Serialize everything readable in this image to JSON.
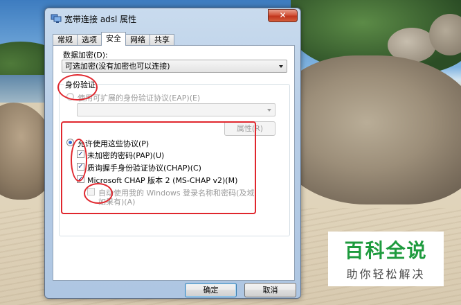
{
  "window": {
    "title": "宽带连接 adsl 属性",
    "close_label": "✕"
  },
  "tabs": [
    "常规",
    "选项",
    "安全",
    "网络",
    "共享"
  ],
  "active_tab": 2,
  "data_encryption": {
    "label": "数据加密(D):",
    "value": "可选加密(没有加密也可以连接)"
  },
  "authentication": {
    "group_title": "身份验证",
    "eap_option": "使用可扩展的身份验证协议(EAP)(E)",
    "eap_select_value": "",
    "properties_button": "属性(R)",
    "allow_protocols_option": "允许使用这些协议(P)",
    "protocols": [
      {
        "label": "未加密的密码(PAP)(U)",
        "checked": true
      },
      {
        "label": "质询握手身份验证协议(CHAP)(C)",
        "checked": true
      },
      {
        "label": "Microsoft CHAP 版本 2 (MS-CHAP v2)(M)",
        "checked": true
      }
    ],
    "auto_windows_logon_line1": "自动使用我的 Windows 登录名称和密码(及域,",
    "auto_windows_logon_line2": "如果有)(A)"
  },
  "footer": {
    "ok_label": "确定",
    "cancel_label": "取消"
  },
  "watermark": {
    "title": "百科全说",
    "subtitle": "助你轻松解决"
  },
  "colors": {
    "annotation": "#e0262d",
    "watermark_green": "#1e9b3e"
  }
}
